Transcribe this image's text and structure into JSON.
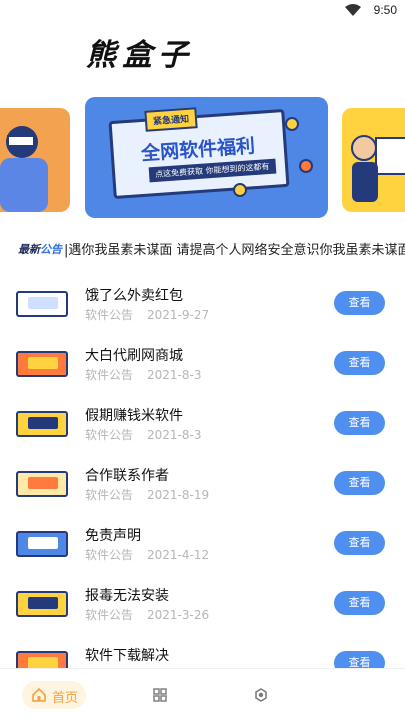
{
  "status_bar": {
    "time": "9:50"
  },
  "logo": {
    "text": "熊盒子"
  },
  "banner": {
    "badge": "紧急通知",
    "title": "全网软件福利",
    "subtitle": "点这免费获取 你能想到的这都有"
  },
  "notice": {
    "tag_a": "最新",
    "tag_b": "公告",
    "text": "|遇你我虽素未谋面 请提高个人网络安全意识你我虽素未谋面 相"
  },
  "list": {
    "button_label": "查看",
    "items": [
      {
        "title": "饿了么外卖红包",
        "category": "软件公告",
        "date": "2021-9-27",
        "thumb_color": "#ffffff",
        "inner_color": "#cfe0ff"
      },
      {
        "title": "大白代刷网商城",
        "category": "软件公告",
        "date": "2021-8-3",
        "thumb_color": "#ff7a3d",
        "inner_color": "#ffd23f"
      },
      {
        "title": "假期赚钱米软件",
        "category": "软件公告",
        "date": "2021-8-3",
        "thumb_color": "#ffd23f",
        "inner_color": "#243a7a"
      },
      {
        "title": "合作联系作者",
        "category": "软件公告",
        "date": "2021-8-19",
        "thumb_color": "#ffe9a8",
        "inner_color": "#ff7a3d"
      },
      {
        "title": "免责声明",
        "category": "软件公告",
        "date": "2021-4-12",
        "thumb_color": "#4e87e6",
        "inner_color": "#ffffff"
      },
      {
        "title": "报毒无法安装",
        "category": "软件公告",
        "date": "2021-3-26",
        "thumb_color": "#ffd23f",
        "inner_color": "#243a7a"
      },
      {
        "title": "软件下载解决",
        "category": "",
        "date": "",
        "thumb_color": "#ff7a3d",
        "inner_color": "#ffd23f"
      }
    ]
  },
  "bottom_nav": {
    "home_label": "首页"
  },
  "colors": {
    "accent": "#4e8ff0",
    "home_accent": "#f2a23a"
  }
}
